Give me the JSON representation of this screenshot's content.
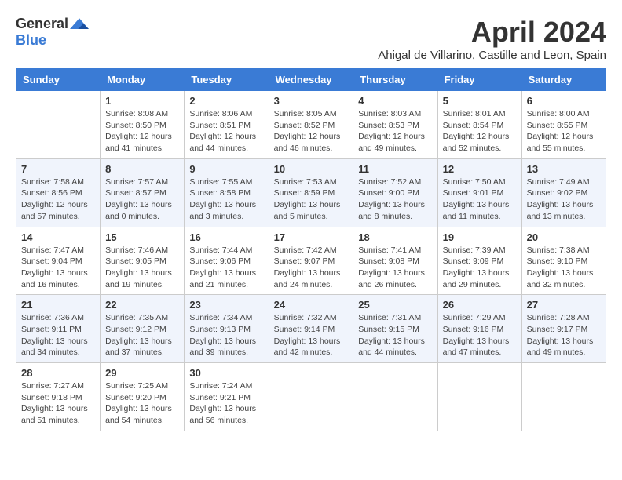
{
  "header": {
    "logo_general": "General",
    "logo_blue": "Blue",
    "title": "April 2024",
    "subtitle": "Ahigal de Villarino, Castille and Leon, Spain"
  },
  "calendar": {
    "columns": [
      "Sunday",
      "Monday",
      "Tuesday",
      "Wednesday",
      "Thursday",
      "Friday",
      "Saturday"
    ],
    "weeks": [
      [
        {
          "day": "",
          "info": ""
        },
        {
          "day": "1",
          "info": "Sunrise: 8:08 AM\nSunset: 8:50 PM\nDaylight: 12 hours\nand 41 minutes."
        },
        {
          "day": "2",
          "info": "Sunrise: 8:06 AM\nSunset: 8:51 PM\nDaylight: 12 hours\nand 44 minutes."
        },
        {
          "day": "3",
          "info": "Sunrise: 8:05 AM\nSunset: 8:52 PM\nDaylight: 12 hours\nand 46 minutes."
        },
        {
          "day": "4",
          "info": "Sunrise: 8:03 AM\nSunset: 8:53 PM\nDaylight: 12 hours\nand 49 minutes."
        },
        {
          "day": "5",
          "info": "Sunrise: 8:01 AM\nSunset: 8:54 PM\nDaylight: 12 hours\nand 52 minutes."
        },
        {
          "day": "6",
          "info": "Sunrise: 8:00 AM\nSunset: 8:55 PM\nDaylight: 12 hours\nand 55 minutes."
        }
      ],
      [
        {
          "day": "7",
          "info": "Sunrise: 7:58 AM\nSunset: 8:56 PM\nDaylight: 12 hours\nand 57 minutes."
        },
        {
          "day": "8",
          "info": "Sunrise: 7:57 AM\nSunset: 8:57 PM\nDaylight: 13 hours\nand 0 minutes."
        },
        {
          "day": "9",
          "info": "Sunrise: 7:55 AM\nSunset: 8:58 PM\nDaylight: 13 hours\nand 3 minutes."
        },
        {
          "day": "10",
          "info": "Sunrise: 7:53 AM\nSunset: 8:59 PM\nDaylight: 13 hours\nand 5 minutes."
        },
        {
          "day": "11",
          "info": "Sunrise: 7:52 AM\nSunset: 9:00 PM\nDaylight: 13 hours\nand 8 minutes."
        },
        {
          "day": "12",
          "info": "Sunrise: 7:50 AM\nSunset: 9:01 PM\nDaylight: 13 hours\nand 11 minutes."
        },
        {
          "day": "13",
          "info": "Sunrise: 7:49 AM\nSunset: 9:02 PM\nDaylight: 13 hours\nand 13 minutes."
        }
      ],
      [
        {
          "day": "14",
          "info": "Sunrise: 7:47 AM\nSunset: 9:04 PM\nDaylight: 13 hours\nand 16 minutes."
        },
        {
          "day": "15",
          "info": "Sunrise: 7:46 AM\nSunset: 9:05 PM\nDaylight: 13 hours\nand 19 minutes."
        },
        {
          "day": "16",
          "info": "Sunrise: 7:44 AM\nSunset: 9:06 PM\nDaylight: 13 hours\nand 21 minutes."
        },
        {
          "day": "17",
          "info": "Sunrise: 7:42 AM\nSunset: 9:07 PM\nDaylight: 13 hours\nand 24 minutes."
        },
        {
          "day": "18",
          "info": "Sunrise: 7:41 AM\nSunset: 9:08 PM\nDaylight: 13 hours\nand 26 minutes."
        },
        {
          "day": "19",
          "info": "Sunrise: 7:39 AM\nSunset: 9:09 PM\nDaylight: 13 hours\nand 29 minutes."
        },
        {
          "day": "20",
          "info": "Sunrise: 7:38 AM\nSunset: 9:10 PM\nDaylight: 13 hours\nand 32 minutes."
        }
      ],
      [
        {
          "day": "21",
          "info": "Sunrise: 7:36 AM\nSunset: 9:11 PM\nDaylight: 13 hours\nand 34 minutes."
        },
        {
          "day": "22",
          "info": "Sunrise: 7:35 AM\nSunset: 9:12 PM\nDaylight: 13 hours\nand 37 minutes."
        },
        {
          "day": "23",
          "info": "Sunrise: 7:34 AM\nSunset: 9:13 PM\nDaylight: 13 hours\nand 39 minutes."
        },
        {
          "day": "24",
          "info": "Sunrise: 7:32 AM\nSunset: 9:14 PM\nDaylight: 13 hours\nand 42 minutes."
        },
        {
          "day": "25",
          "info": "Sunrise: 7:31 AM\nSunset: 9:15 PM\nDaylight: 13 hours\nand 44 minutes."
        },
        {
          "day": "26",
          "info": "Sunrise: 7:29 AM\nSunset: 9:16 PM\nDaylight: 13 hours\nand 47 minutes."
        },
        {
          "day": "27",
          "info": "Sunrise: 7:28 AM\nSunset: 9:17 PM\nDaylight: 13 hours\nand 49 minutes."
        }
      ],
      [
        {
          "day": "28",
          "info": "Sunrise: 7:27 AM\nSunset: 9:18 PM\nDaylight: 13 hours\nand 51 minutes."
        },
        {
          "day": "29",
          "info": "Sunrise: 7:25 AM\nSunset: 9:20 PM\nDaylight: 13 hours\nand 54 minutes."
        },
        {
          "day": "30",
          "info": "Sunrise: 7:24 AM\nSunset: 9:21 PM\nDaylight: 13 hours\nand 56 minutes."
        },
        {
          "day": "",
          "info": ""
        },
        {
          "day": "",
          "info": ""
        },
        {
          "day": "",
          "info": ""
        },
        {
          "day": "",
          "info": ""
        }
      ]
    ]
  }
}
